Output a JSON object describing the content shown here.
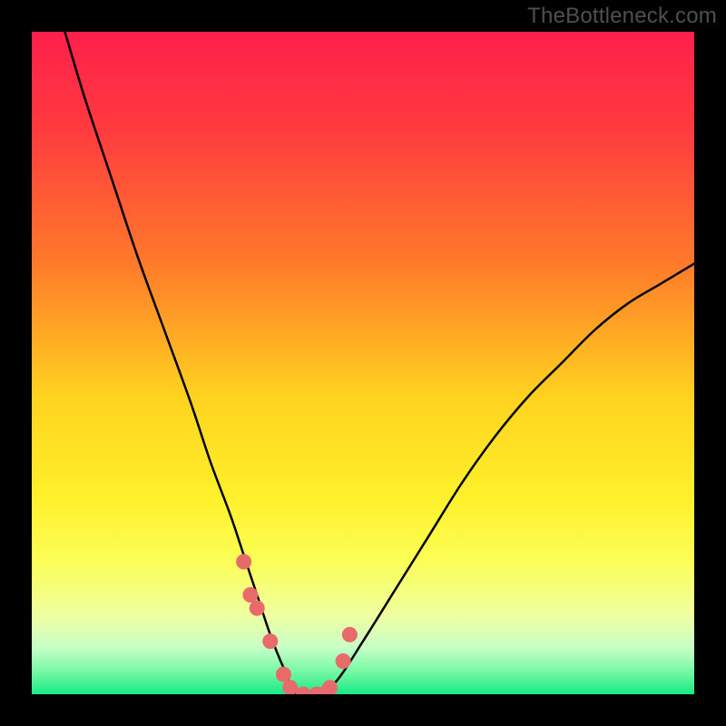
{
  "watermark": "TheBottleneck.com",
  "chart_data": {
    "type": "line",
    "title": "",
    "xlabel": "",
    "ylabel": "",
    "xlim": [
      0,
      100
    ],
    "ylim": [
      0,
      100
    ],
    "gradient_stops": [
      {
        "offset": 0.0,
        "color": "#ff1f4b"
      },
      {
        "offset": 0.15,
        "color": "#ff3b3f"
      },
      {
        "offset": 0.35,
        "color": "#ff7a2a"
      },
      {
        "offset": 0.55,
        "color": "#ffd21f"
      },
      {
        "offset": 0.7,
        "color": "#fff02a"
      },
      {
        "offset": 0.8,
        "color": "#fbff56"
      },
      {
        "offset": 0.88,
        "color": "#f0ffa0"
      },
      {
        "offset": 0.93,
        "color": "#c7ffc7"
      },
      {
        "offset": 0.97,
        "color": "#6cf7a0"
      },
      {
        "offset": 1.0,
        "color": "#17e884"
      }
    ],
    "series": [
      {
        "name": "curve",
        "x": [
          5,
          8,
          12,
          16,
          20,
          24,
          27,
          30,
          32,
          34,
          36,
          38,
          40,
          43,
          46,
          50,
          55,
          60,
          65,
          70,
          75,
          80,
          85,
          90,
          95,
          100
        ],
        "values": [
          100,
          90,
          78,
          66,
          55,
          44,
          35,
          27,
          21,
          15,
          9,
          4,
          0,
          0,
          2,
          8,
          16,
          24,
          32,
          39,
          45,
          50,
          55,
          59,
          62,
          65
        ]
      }
    ],
    "highlight_points": {
      "name": "dots",
      "color": "#e96a6a",
      "x": [
        32,
        33,
        34,
        36,
        38,
        39,
        41,
        43,
        44,
        45,
        47,
        48
      ],
      "values": [
        20,
        15,
        13,
        8,
        3,
        1,
        0,
        0,
        0,
        1,
        5,
        9
      ]
    }
  }
}
